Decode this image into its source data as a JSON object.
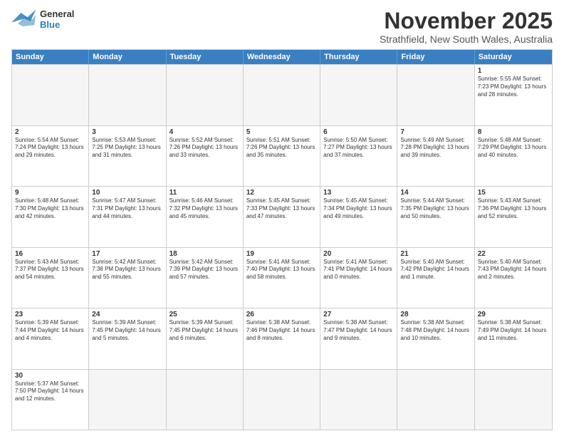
{
  "header": {
    "logo_general": "General",
    "logo_blue": "Blue",
    "month_title": "November 2025",
    "subtitle": "Strathfield, New South Wales, Australia"
  },
  "weekdays": [
    "Sunday",
    "Monday",
    "Tuesday",
    "Wednesday",
    "Thursday",
    "Friday",
    "Saturday"
  ],
  "rows": [
    [
      {
        "day": "",
        "content": ""
      },
      {
        "day": "",
        "content": ""
      },
      {
        "day": "",
        "content": ""
      },
      {
        "day": "",
        "content": ""
      },
      {
        "day": "",
        "content": ""
      },
      {
        "day": "",
        "content": ""
      },
      {
        "day": "1",
        "content": "Sunrise: 5:55 AM\nSunset: 7:23 PM\nDaylight: 13 hours\nand 28 minutes."
      }
    ],
    [
      {
        "day": "2",
        "content": "Sunrise: 5:54 AM\nSunset: 7:24 PM\nDaylight: 13 hours\nand 29 minutes."
      },
      {
        "day": "3",
        "content": "Sunrise: 5:53 AM\nSunset: 7:25 PM\nDaylight: 13 hours\nand 31 minutes."
      },
      {
        "day": "4",
        "content": "Sunrise: 5:52 AM\nSunset: 7:26 PM\nDaylight: 13 hours\nand 33 minutes."
      },
      {
        "day": "5",
        "content": "Sunrise: 5:51 AM\nSunset: 7:26 PM\nDaylight: 13 hours\nand 35 minutes."
      },
      {
        "day": "6",
        "content": "Sunrise: 5:50 AM\nSunset: 7:27 PM\nDaylight: 13 hours\nand 37 minutes."
      },
      {
        "day": "7",
        "content": "Sunrise: 5:49 AM\nSunset: 7:28 PM\nDaylight: 13 hours\nand 39 minutes."
      },
      {
        "day": "8",
        "content": "Sunrise: 5:48 AM\nSunset: 7:29 PM\nDaylight: 13 hours\nand 40 minutes."
      }
    ],
    [
      {
        "day": "9",
        "content": "Sunrise: 5:48 AM\nSunset: 7:30 PM\nDaylight: 13 hours\nand 42 minutes."
      },
      {
        "day": "10",
        "content": "Sunrise: 5:47 AM\nSunset: 7:31 PM\nDaylight: 13 hours\nand 44 minutes."
      },
      {
        "day": "11",
        "content": "Sunrise: 5:46 AM\nSunset: 7:32 PM\nDaylight: 13 hours\nand 45 minutes."
      },
      {
        "day": "12",
        "content": "Sunrise: 5:45 AM\nSunset: 7:33 PM\nDaylight: 13 hours\nand 47 minutes."
      },
      {
        "day": "13",
        "content": "Sunrise: 5:45 AM\nSunset: 7:34 PM\nDaylight: 13 hours\nand 49 minutes."
      },
      {
        "day": "14",
        "content": "Sunrise: 5:44 AM\nSunset: 7:35 PM\nDaylight: 13 hours\nand 50 minutes."
      },
      {
        "day": "15",
        "content": "Sunrise: 5:43 AM\nSunset: 7:36 PM\nDaylight: 13 hours\nand 52 minutes."
      }
    ],
    [
      {
        "day": "16",
        "content": "Sunrise: 5:43 AM\nSunset: 7:37 PM\nDaylight: 13 hours\nand 54 minutes."
      },
      {
        "day": "17",
        "content": "Sunrise: 5:42 AM\nSunset: 7:38 PM\nDaylight: 13 hours\nand 55 minutes."
      },
      {
        "day": "18",
        "content": "Sunrise: 5:42 AM\nSunset: 7:39 PM\nDaylight: 13 hours\nand 57 minutes."
      },
      {
        "day": "19",
        "content": "Sunrise: 5:41 AM\nSunset: 7:40 PM\nDaylight: 13 hours\nand 58 minutes."
      },
      {
        "day": "20",
        "content": "Sunrise: 5:41 AM\nSunset: 7:41 PM\nDaylight: 14 hours\nand 0 minutes."
      },
      {
        "day": "21",
        "content": "Sunrise: 5:40 AM\nSunset: 7:42 PM\nDaylight: 14 hours\nand 1 minute."
      },
      {
        "day": "22",
        "content": "Sunrise: 5:40 AM\nSunset: 7:43 PM\nDaylight: 14 hours\nand 2 minutes."
      }
    ],
    [
      {
        "day": "23",
        "content": "Sunrise: 5:39 AM\nSunset: 7:44 PM\nDaylight: 14 hours\nand 4 minutes."
      },
      {
        "day": "24",
        "content": "Sunrise: 5:39 AM\nSunset: 7:45 PM\nDaylight: 14 hours\nand 5 minutes."
      },
      {
        "day": "25",
        "content": "Sunrise: 5:39 AM\nSunset: 7:45 PM\nDaylight: 14 hours\nand 6 minutes."
      },
      {
        "day": "26",
        "content": "Sunrise: 5:38 AM\nSunset: 7:46 PM\nDaylight: 14 hours\nand 8 minutes."
      },
      {
        "day": "27",
        "content": "Sunrise: 5:38 AM\nSunset: 7:47 PM\nDaylight: 14 hours\nand 9 minutes."
      },
      {
        "day": "28",
        "content": "Sunrise: 5:38 AM\nSunset: 7:48 PM\nDaylight: 14 hours\nand 10 minutes."
      },
      {
        "day": "29",
        "content": "Sunrise: 5:38 AM\nSunset: 7:49 PM\nDaylight: 14 hours\nand 11 minutes."
      }
    ],
    [
      {
        "day": "30",
        "content": "Sunrise: 5:37 AM\nSunset: 7:50 PM\nDaylight: 14 hours\nand 12 minutes."
      },
      {
        "day": "",
        "content": ""
      },
      {
        "day": "",
        "content": ""
      },
      {
        "day": "",
        "content": ""
      },
      {
        "day": "",
        "content": ""
      },
      {
        "day": "",
        "content": ""
      },
      {
        "day": "",
        "content": ""
      }
    ]
  ]
}
